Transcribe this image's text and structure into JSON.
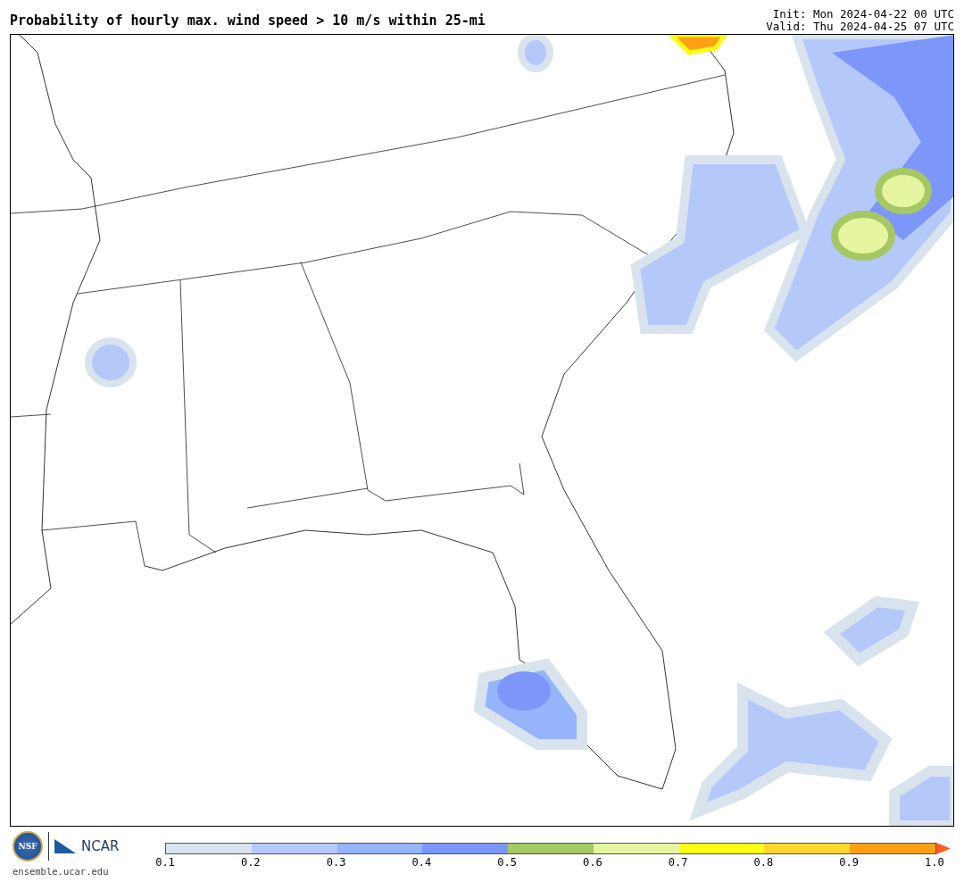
{
  "title": "Probability of hourly max. wind speed > 10 m/s within 25-mi",
  "init": "Init: Mon 2024-04-22 00 UTC",
  "valid": "Valid: Thu 2024-04-25 07 UTC",
  "logos": {
    "nsf": "NSF",
    "ncar": "NCAR",
    "url": "ensemble.ucar.edu"
  },
  "colorbar": {
    "bins": [
      {
        "kind": "segment",
        "color": "#d9e3ee"
      },
      {
        "kind": "segment",
        "color": "#b4c8fa"
      },
      {
        "kind": "segment",
        "color": "#96b4fa"
      },
      {
        "kind": "segment",
        "color": "#7d96fa"
      },
      {
        "kind": "segment",
        "color": "#a5c864"
      },
      {
        "kind": "segment",
        "color": "#e6f5a0"
      },
      {
        "kind": "segment",
        "color": "#ffff14"
      },
      {
        "kind": "segment",
        "color": "#ffd72d"
      },
      {
        "kind": "segment",
        "color": "#ffa014"
      },
      {
        "kind": "arrow",
        "color": "#ff5a1e"
      }
    ],
    "ticks": [
      "0.1",
      "0.2",
      "0.3",
      "0.4",
      "0.5",
      "0.6",
      "0.7",
      "0.8",
      "0.9",
      "1.0"
    ]
  }
}
